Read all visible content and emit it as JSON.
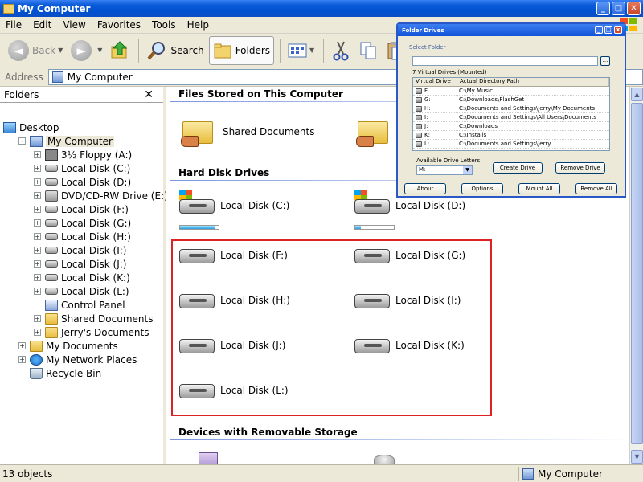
{
  "window": {
    "title": "My Computer"
  },
  "menu": [
    "File",
    "Edit",
    "View",
    "Favorites",
    "Tools",
    "Help"
  ],
  "toolbar": {
    "back": "Back",
    "search": "Search",
    "folders": "Folders"
  },
  "address": {
    "label": "Address",
    "value": "My Computer"
  },
  "folders_pane": {
    "title": "Folders",
    "close": "✕",
    "items": [
      {
        "label": "Desktop",
        "icon": "desktop-icon"
      },
      {
        "label": "My Computer",
        "icon": "computer-icon"
      },
      {
        "label": "3½ Floppy (A:)",
        "icon": "floppy-icon"
      },
      {
        "label": "Local Disk (C:)",
        "icon": "drive-icon"
      },
      {
        "label": "Local Disk (D:)",
        "icon": "drive-icon"
      },
      {
        "label": "DVD/CD-RW Drive (E:)",
        "icon": "cd-drive-icon"
      },
      {
        "label": "Local Disk (F:)",
        "icon": "drive-icon"
      },
      {
        "label": "Local Disk (G:)",
        "icon": "drive-icon"
      },
      {
        "label": "Local Disk (H:)",
        "icon": "drive-icon"
      },
      {
        "label": "Local Disk (I:)",
        "icon": "drive-icon"
      },
      {
        "label": "Local Disk (J:)",
        "icon": "drive-icon"
      },
      {
        "label": "Local Disk (K:)",
        "icon": "drive-icon"
      },
      {
        "label": "Local Disk (L:)",
        "icon": "drive-icon"
      },
      {
        "label": "Control Panel",
        "icon": "control-panel-icon"
      },
      {
        "label": "Shared Documents",
        "icon": "folder-icon"
      },
      {
        "label": "Jerry's Documents",
        "icon": "folder-icon"
      },
      {
        "label": "My Documents",
        "icon": "documents-icon"
      },
      {
        "label": "My Network Places",
        "icon": "network-icon"
      },
      {
        "label": "Recycle Bin",
        "icon": "recycle-bin-icon"
      }
    ]
  },
  "content": {
    "group_files": "Files Stored on This Computer",
    "group_hdd": "Hard Disk Drives",
    "group_removable": "Devices with Removable Storage",
    "shared": "Shared Documents",
    "drives": [
      {
        "label": "Local Disk (C:)",
        "usage": 0.9
      },
      {
        "label": "Local Disk (D:)",
        "usage": 0.15
      },
      {
        "label": "Local Disk (F:)"
      },
      {
        "label": "Local Disk (G:)"
      },
      {
        "label": "Local Disk (H:)"
      },
      {
        "label": "Local Disk (I:)"
      },
      {
        "label": "Local Disk (J:)"
      },
      {
        "label": "Local Disk (K:)"
      },
      {
        "label": "Local Disk (L:)"
      }
    ]
  },
  "status": {
    "left": "13 objects",
    "right": "My Computer"
  },
  "dialog": {
    "title": "Folder Drives",
    "select_folder": "Select Folder",
    "browse": "...",
    "mounted": "7 Virtual Drives (Mounted)",
    "col_drive": "Virtual Drive",
    "col_path": "Actual Directory Path",
    "rows": [
      {
        "drive": "F:",
        "path": "C:\\My Music"
      },
      {
        "drive": "G:",
        "path": "C:\\Downloads\\FlashGet"
      },
      {
        "drive": "H:",
        "path": "C:\\Documents and Settings\\Jerry\\My Documents"
      },
      {
        "drive": "I:",
        "path": "C:\\Documents and Settings\\All Users\\Documents"
      },
      {
        "drive": "J:",
        "path": "C:\\Downloads"
      },
      {
        "drive": "K:",
        "path": "C:\\Installs"
      },
      {
        "drive": "L:",
        "path": "C:\\Documents and Settings\\Jerry"
      }
    ],
    "available_label": "Available Drive Letters",
    "available_value": "M:",
    "create": "Create Drive",
    "remove": "Remove Drive",
    "about": "About",
    "options": "Options",
    "mount_all": "Mount All",
    "remove_all": "Remove All"
  }
}
